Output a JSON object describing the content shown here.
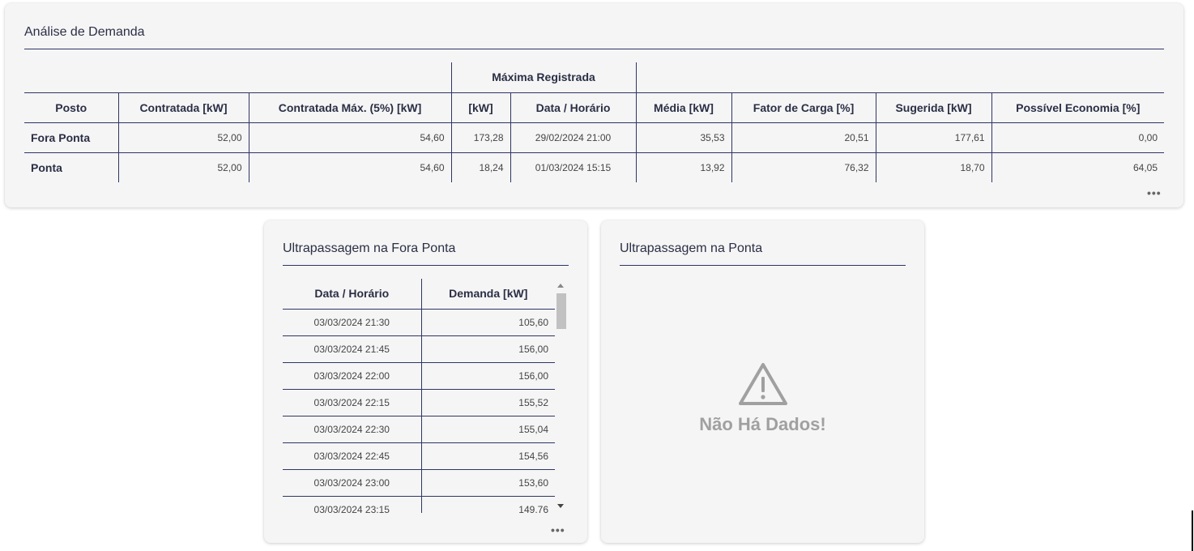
{
  "demand_analysis": {
    "title": "Análise de Demanda",
    "group_header": "Máxima Registrada",
    "columns": {
      "posto": "Posto",
      "contratada": "Contratada [kW]",
      "contratada_max": "Contratada Máx. (5%) [kW]",
      "max_kw": "[kW]",
      "max_datetime": "Data / Horário",
      "media": "Média [kW]",
      "fator_carga": "Fator de Carga [%]",
      "sugerida": "Sugerida [kW]",
      "economia": "Possível Economia [%]"
    },
    "rows": [
      {
        "posto": "Fora Ponta",
        "contratada": "52,00",
        "contratada_max": "54,60",
        "max_kw": "173,28",
        "max_datetime": "29/02/2024 21:00",
        "media": "35,53",
        "fator_carga": "20,51",
        "sugerida": "177,61",
        "economia": "0,00"
      },
      {
        "posto": "Ponta",
        "contratada": "52,00",
        "contratada_max": "54,60",
        "max_kw": "18,24",
        "max_datetime": "01/03/2024 15:15",
        "media": "13,92",
        "fator_carga": "76,32",
        "sugerida": "18,70",
        "economia": "64,05"
      }
    ],
    "more_label": "•••"
  },
  "overrun_fora_ponta": {
    "title": "Ultrapassagem na Fora Ponta",
    "columns": {
      "datetime": "Data / Horário",
      "demand": "Demanda [kW]"
    },
    "rows": [
      {
        "datetime": "03/03/2024 21:30",
        "demand": "105,60"
      },
      {
        "datetime": "03/03/2024 21:45",
        "demand": "156,00"
      },
      {
        "datetime": "03/03/2024 22:00",
        "demand": "156,00"
      },
      {
        "datetime": "03/03/2024 22:15",
        "demand": "155,52"
      },
      {
        "datetime": "03/03/2024 22:30",
        "demand": "155,04"
      },
      {
        "datetime": "03/03/2024 22:45",
        "demand": "154,56"
      },
      {
        "datetime": "03/03/2024 23:00",
        "demand": "153,60"
      },
      {
        "datetime": "03/03/2024 23:15",
        "demand": "149,76"
      }
    ],
    "more_label": "•••"
  },
  "overrun_ponta": {
    "title": "Ultrapassagem na Ponta",
    "empty_message": "Não Há Dados!",
    "empty_icon": "warning-triangle-icon"
  },
  "colors": {
    "rule": "#2e3566",
    "card_bg": "#f5f5f5",
    "empty_text": "#a0a0a0"
  }
}
